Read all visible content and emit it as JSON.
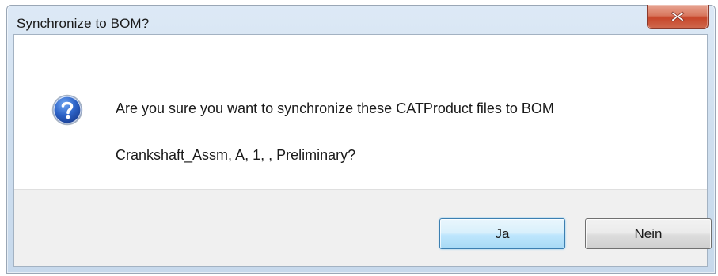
{
  "window": {
    "title": "Synchronize to BOM?"
  },
  "titlebar": {
    "close_icon": "close-icon"
  },
  "message": {
    "icon": "question-icon",
    "line1": "Are you sure you want to synchronize these CATProduct files to BOM",
    "line2": "Crankshaft_Assm, A, 1, , Preliminary?"
  },
  "buttons": {
    "yes_label": "Ja",
    "no_label": "Nein"
  },
  "colors": {
    "title_gradient": "#cfdfef",
    "close_red": "#c7462a",
    "default_button_blue": "#bee6fd",
    "button_strip": "#f0f0f0",
    "question_icon_blue": "#1f55b8"
  }
}
